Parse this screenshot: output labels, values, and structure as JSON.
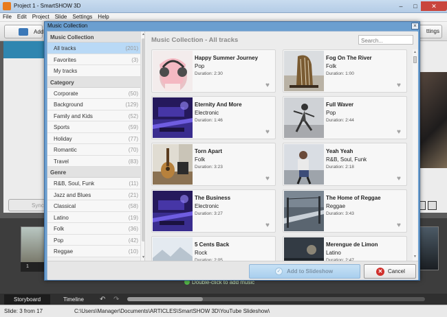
{
  "app": {
    "title": "Project 1 - SmartSHOW 3D",
    "menu": [
      "File",
      "Edit",
      "Project",
      "Slide",
      "Settings",
      "Help"
    ],
    "toolbar": {
      "add_label": "Add",
      "settings_label": "ttings"
    },
    "sync_label": "Sync",
    "timeline": {
      "slide_number": "1",
      "hint": "Double-click to add music"
    },
    "tabs": {
      "storyboard": "Storyboard",
      "timeline": "Timeline"
    },
    "status": {
      "slide": "Slide: 3 from 17",
      "path": "C:\\Users\\Manager\\Documents\\ARTICLES\\SmartSHOW 3D\\YouTube Slideshow\\"
    }
  },
  "dialog": {
    "title": "Music Collection",
    "sections": [
      {
        "heading": "Music Collection",
        "items": [
          {
            "label": "All tracks",
            "count": "(201)",
            "selected": true
          },
          {
            "label": "Favorites",
            "count": "(3)"
          },
          {
            "label": "My tracks",
            "count": ""
          }
        ]
      },
      {
        "heading": "Category",
        "items": [
          {
            "label": "Corporate",
            "count": "(50)"
          },
          {
            "label": "Background",
            "count": "(129)"
          },
          {
            "label": "Family and Kids",
            "count": "(52)"
          },
          {
            "label": "Sports",
            "count": "(59)"
          },
          {
            "label": "Holiday",
            "count": "(77)"
          },
          {
            "label": "Romantic",
            "count": "(70)"
          },
          {
            "label": "Travel",
            "count": "(83)"
          }
        ]
      },
      {
        "heading": "Genre",
        "items": [
          {
            "label": "R&B, Soul, Funk",
            "count": "(11)"
          },
          {
            "label": "Jazz and Blues",
            "count": "(21)"
          },
          {
            "label": "Classical",
            "count": "(58)"
          },
          {
            "label": "Latino",
            "count": "(19)"
          },
          {
            "label": "Folk",
            "count": "(36)"
          },
          {
            "label": "Pop",
            "count": "(42)"
          },
          {
            "label": "Reggae",
            "count": "(10)"
          }
        ]
      }
    ],
    "heading": "Music Collection - All tracks",
    "search_placeholder": "Search...",
    "tracks": [
      {
        "title": "Happy Summer Journey",
        "genre": "Pop",
        "duration": "Duration: 2:30",
        "art": "headphones"
      },
      {
        "title": "Fog On The River",
        "genre": "Folk",
        "duration": "Duration: 1:00",
        "art": "harp"
      },
      {
        "title": "Eternity And More",
        "genre": "Electronic",
        "duration": "Duration: 1:46",
        "art": "purple"
      },
      {
        "title": "Full Waver",
        "genre": "Pop",
        "duration": "Duration: 2:44",
        "art": "dancer"
      },
      {
        "title": "Torn Apart",
        "genre": "Folk",
        "duration": "Duration: 3:23",
        "art": "guitar"
      },
      {
        "title": "Yeah Yeah",
        "genre": "R&B, Soul, Funk",
        "duration": "Duration: 2:18",
        "art": "girl"
      },
      {
        "title": "The Business",
        "genre": "Electronic",
        "duration": "Duration: 3:27",
        "art": "purple"
      },
      {
        "title": "The Home of Reggae",
        "genre": "Reggae",
        "duration": "Duration: 3:43",
        "art": "boardwalk"
      },
      {
        "title": "5 Cents Back",
        "genre": "Rock",
        "duration": "Duration: 2:05",
        "art": "snow"
      },
      {
        "title": "Merengue de Limon",
        "genre": "Latino",
        "duration": "Duration: 2:47",
        "art": "dark"
      }
    ],
    "add_label": "Add to Slideshow",
    "cancel_label": "Cancel"
  }
}
